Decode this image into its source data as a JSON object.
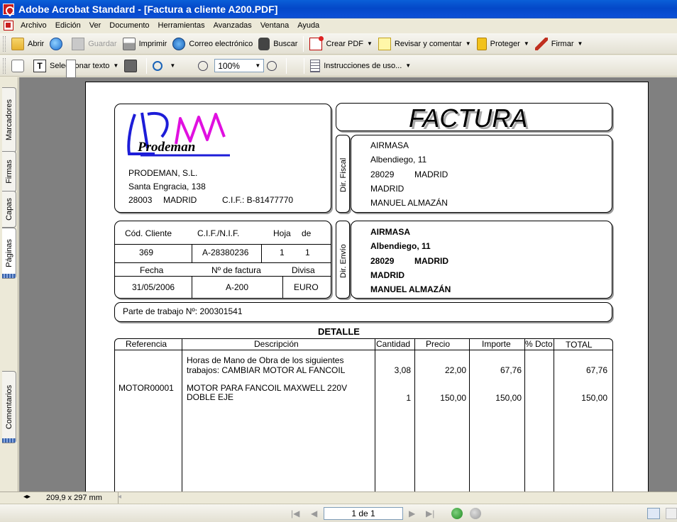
{
  "window": {
    "title": "Adobe Acrobat Standard - [Factura a cliente A200.PDF]"
  },
  "menu": [
    "Archivo",
    "Edición",
    "Ver",
    "Documento",
    "Herramientas",
    "Avanzadas",
    "Ventana",
    "Ayuda"
  ],
  "toolbar1": {
    "open": "Abrir",
    "save": "Guardar",
    "print": "Imprimir",
    "email": "Correo electrónico",
    "search": "Buscar",
    "create_pdf": "Crear PDF",
    "review": "Revisar y comentar",
    "protect": "Proteger",
    "sign": "Firmar"
  },
  "toolbar2": {
    "select_text": "Seleccionar texto",
    "zoom": "100%",
    "how_to": "Instrucciones de uso..."
  },
  "nav_tabs": [
    "Marcadores",
    "Firmas",
    "Capas",
    "Páginas",
    "Comentarios"
  ],
  "invoice": {
    "title": "FACTURA",
    "logo_text": "Prodeman",
    "company": {
      "name": "PRODEMAN, S.L.",
      "street": "Santa Engracia, 138",
      "zip": "28003",
      "city": "MADRID",
      "cif": "C.I.F.: B-81477770"
    },
    "fiscal_label": "Dir. Fiscal",
    "fiscal": {
      "name": "AIRMASA",
      "street": "Albendiego, 11",
      "zip": "28029",
      "city": "MADRID",
      "province": "MADRID",
      "contact": "MANUEL ALMAZÁN"
    },
    "shipping_label": "Dir. Envío",
    "shipping": {
      "name": "AIRMASA",
      "street": "Albendiego, 11",
      "zip": "28029",
      "city": "MADRID",
      "province": "MADRID",
      "contact": "MANUEL ALMAZÁN"
    },
    "info": {
      "h_cliente": "Cód. Cliente",
      "h_cif": "C.I.F./N.I.F.",
      "h_hoja": "Hoja",
      "h_de": "de",
      "cliente": "369",
      "cif": "A-28380236",
      "hoja": "1",
      "de": "1",
      "h_fecha": "Fecha",
      "h_factura": "Nº de factura",
      "h_divisa": "Divisa",
      "fecha": "31/05/2006",
      "factura": "A-200",
      "divisa": "EURO"
    },
    "work_order": "Parte de trabajo Nº: 200301541",
    "detail_title": "DETALLE",
    "columns": [
      "Referencia",
      "Descripción",
      "Cantidad",
      "Precio",
      "Importe",
      "% Dcto",
      "TOTAL"
    ],
    "rows": [
      {
        "ref": "",
        "desc1": "Horas de Mano de Obra de los siguientes",
        "desc2": "trabajos: CAMBIAR MOTOR AL FANCOIL",
        "qty": "3,08",
        "price": "22,00",
        "amount": "67,76",
        "disc": "",
        "total": "67,76"
      },
      {
        "ref": "MOTOR00001",
        "desc1": "MOTOR PARA FANCOIL MAXWELL 220V",
        "desc2": "DOBLE EJE",
        "qty": "1",
        "price": "150,00",
        "amount": "150,00",
        "disc": "",
        "total": "150,00"
      }
    ]
  },
  "status": {
    "page_size": "209,9 x 297 mm",
    "page_indicator": "1 de 1"
  }
}
